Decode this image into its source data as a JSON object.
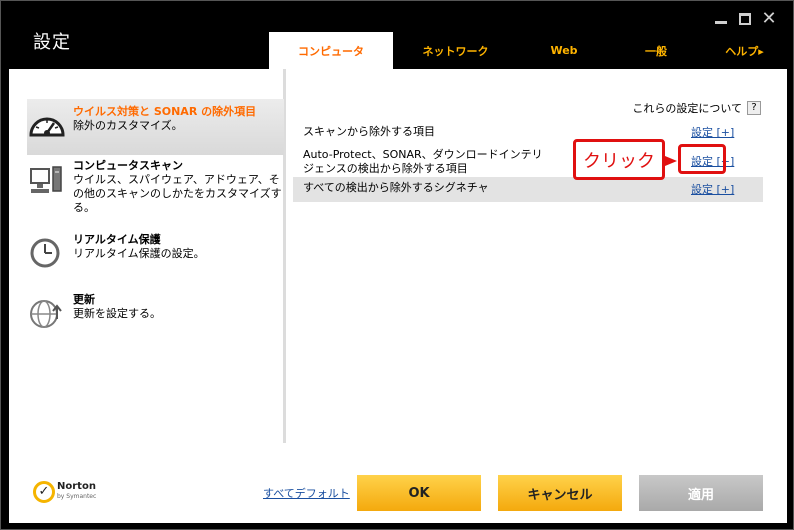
{
  "window": {
    "title": "設定"
  },
  "tabs": [
    {
      "label": "コンピュータ",
      "active": true
    },
    {
      "label": "ネットワーク"
    },
    {
      "label": "Web"
    },
    {
      "label": "一般"
    },
    {
      "label": "ヘルプ▸"
    }
  ],
  "sidebar": {
    "items": [
      {
        "title": "ウイルス対策と SONAR の除外項目",
        "desc": "除外のカスタマイズ。",
        "icon": "speedometer-icon",
        "active": true
      },
      {
        "title": "コンピュータスキャン",
        "desc": "ウイルス、スパイウェア、アドウェア、その他のスキャンのしかたをカスタマイズする。",
        "icon": "computer-scan-icon"
      },
      {
        "title": "リアルタイム保護",
        "desc": "リアルタイム保護の設定。",
        "icon": "clock-icon"
      },
      {
        "title": "更新",
        "desc": "更新を設定する。",
        "icon": "globe-update-icon"
      }
    ]
  },
  "main": {
    "about_label": "これらの設定について",
    "help_label": "?",
    "rows": [
      {
        "label": "スキャンから除外する項目",
        "link": "設定 [+]"
      },
      {
        "label": "Auto-Protect、SONAR、ダウンロードインテリジェンスの検出から除外する項目",
        "link": "設定 [+]"
      },
      {
        "label": "すべての検出から除外するシグネチャ",
        "link": "設定 [+]"
      }
    ]
  },
  "annotation": {
    "label": "クリック",
    "color": "#e01010"
  },
  "footer": {
    "brand": "Norton",
    "brand_sub": "by Symantec",
    "default_link": "すべてデフォルト",
    "ok": "OK",
    "cancel": "キャンセル",
    "apply": "適用"
  }
}
